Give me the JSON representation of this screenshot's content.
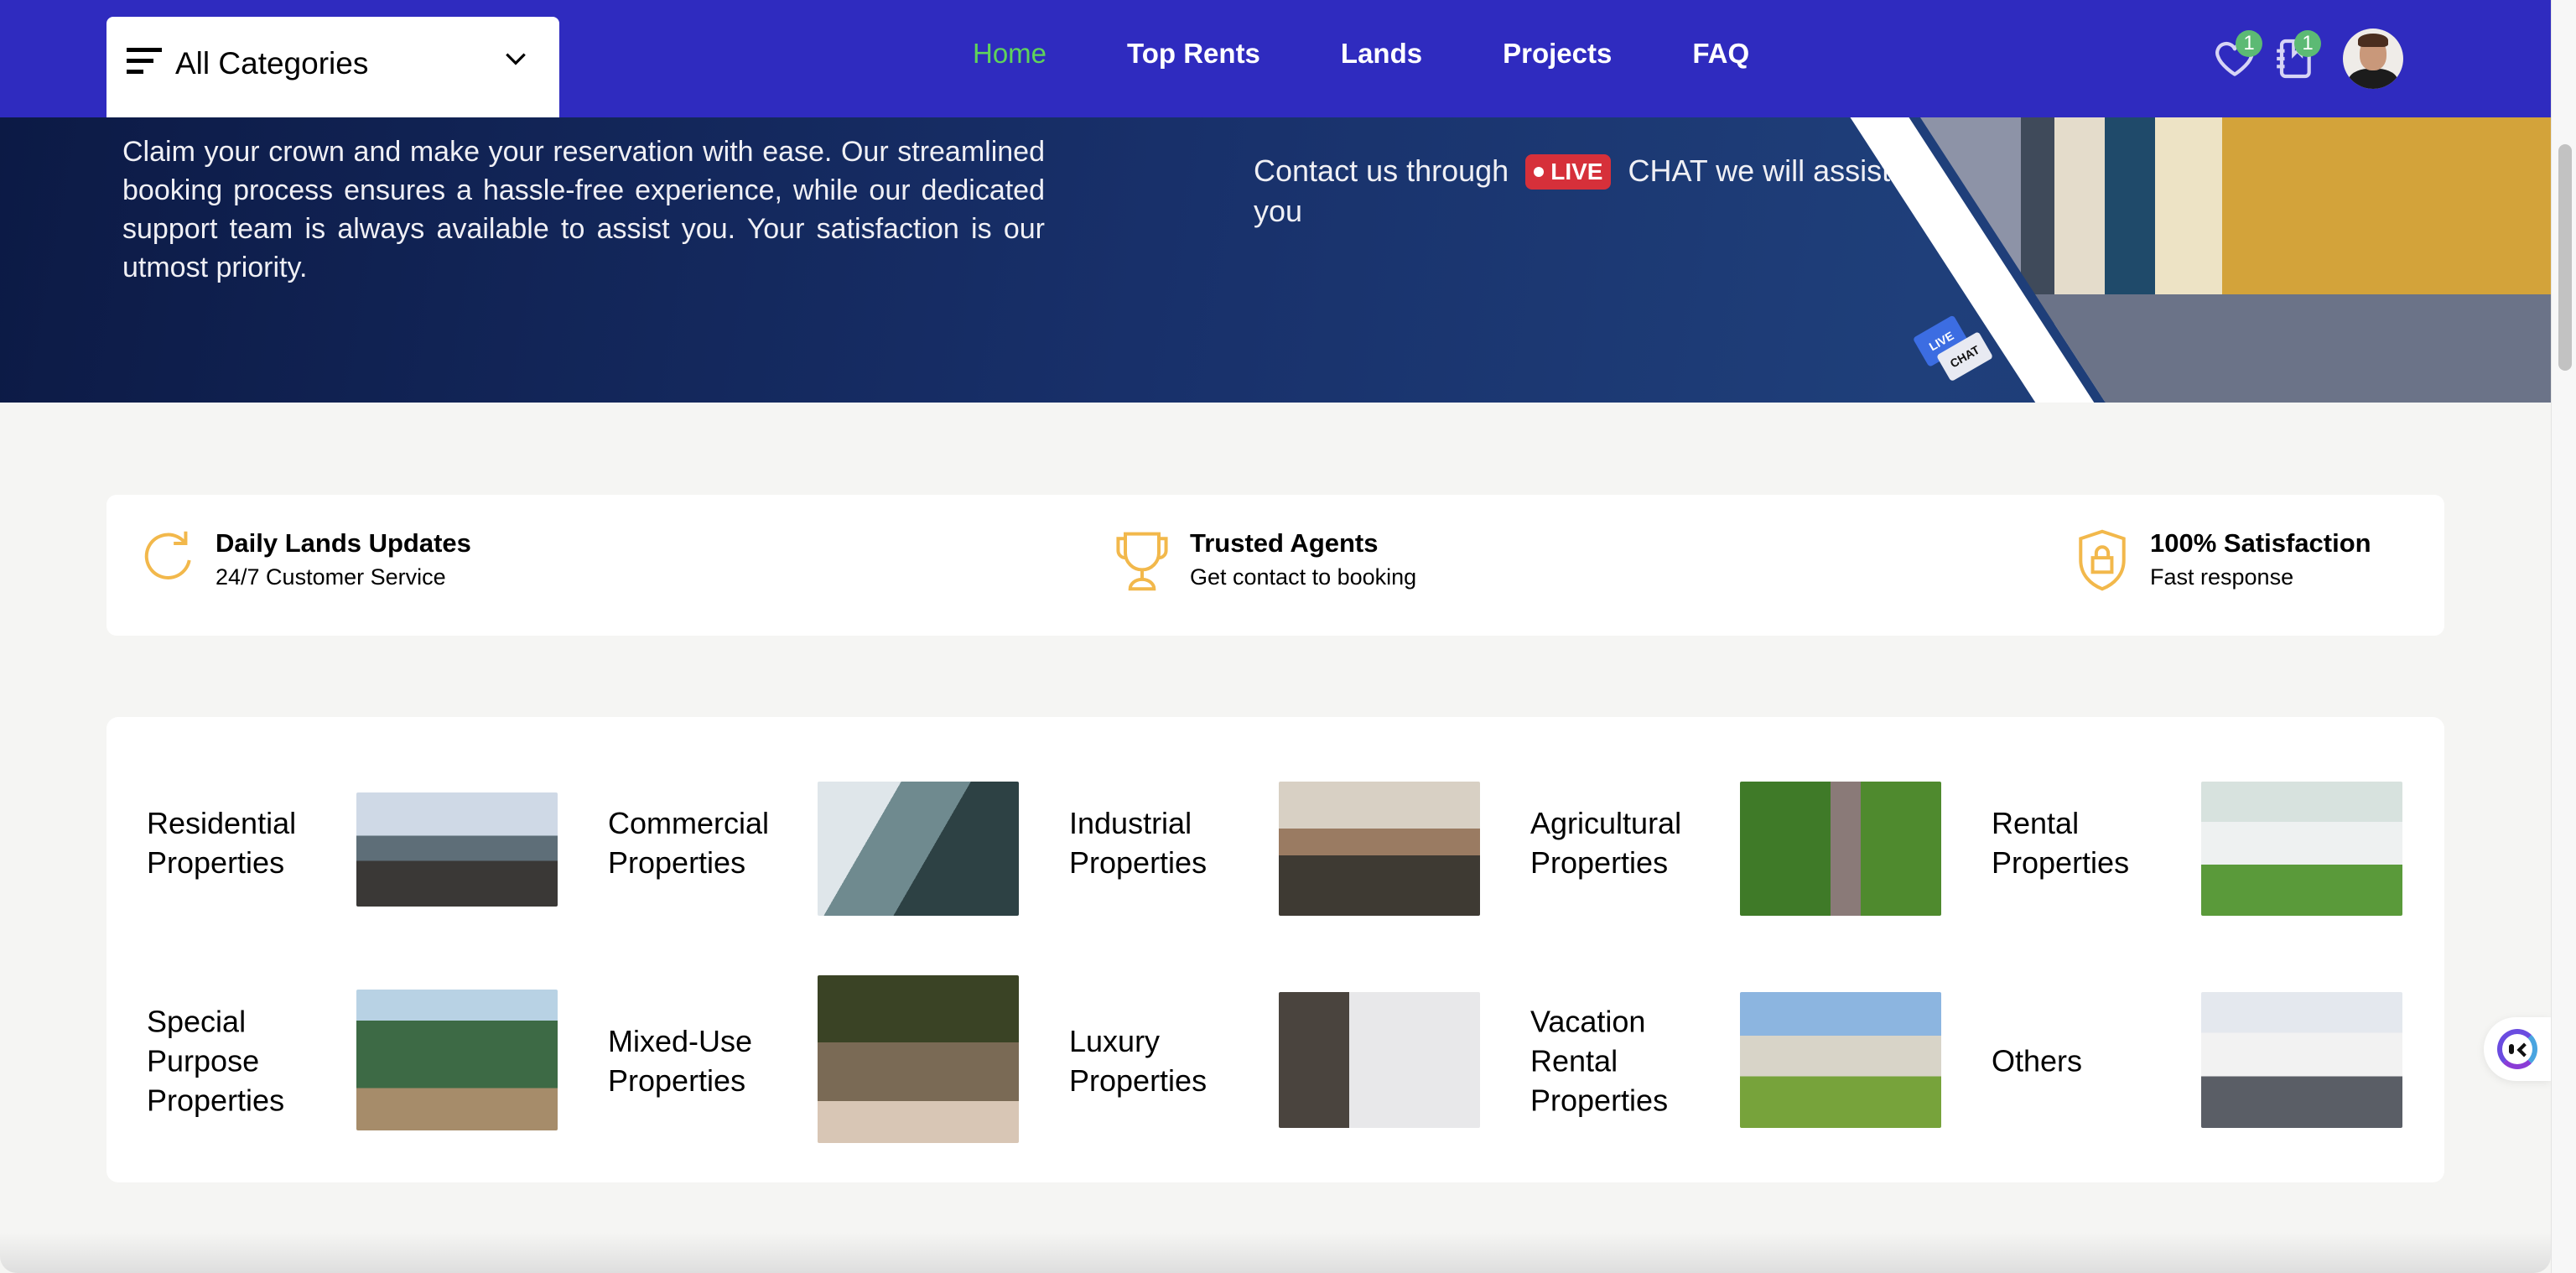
{
  "header": {
    "categories_label": "All Categories",
    "nav": [
      {
        "label": "Home",
        "active": true
      },
      {
        "label": "Top Rents",
        "active": false
      },
      {
        "label": "Lands",
        "active": false
      },
      {
        "label": "Projects",
        "active": false
      },
      {
        "label": "FAQ",
        "active": false
      }
    ],
    "wishlist_count": "1",
    "notebook_count": "1",
    "colors": {
      "bar": "#2F2BBF",
      "active_nav": "#5FD35B",
      "badge": "#5CBA74"
    }
  },
  "banner": {
    "paragraph": "Claim your crown and make your reservation with ease. Our streamlined booking process ensures a hassle-free experience, while our dedicated support team is always available to assist you. Your satisfaction is our utmost priority.",
    "contact_prefix": "Contact us through",
    "live_label": "LIVE",
    "contact_suffix": "CHAT we will assist you",
    "sticker_top": "LIVE",
    "sticker_bottom": "CHAT"
  },
  "features": [
    {
      "icon": "refresh-icon",
      "title": "Daily Lands Updates",
      "subtitle": "24/7 Customer Service"
    },
    {
      "icon": "trophy-icon",
      "title": "Trusted Agents",
      "subtitle": "Get contact to booking"
    },
    {
      "icon": "shield-lock-icon",
      "title": "100% Satisfaction",
      "subtitle": "Fast response"
    }
  ],
  "categories": [
    {
      "name": "Residential Properties"
    },
    {
      "name": "Commercial Properties"
    },
    {
      "name": "Industrial Properties"
    },
    {
      "name": "Agricultural Properties"
    },
    {
      "name": "Rental Properties"
    },
    {
      "name": "Special Purpose Properties"
    },
    {
      "name": "Mixed-Use Properties"
    },
    {
      "name": "Luxury Properties"
    },
    {
      "name": "Vacation Rental Properties"
    },
    {
      "name": "Others"
    }
  ]
}
